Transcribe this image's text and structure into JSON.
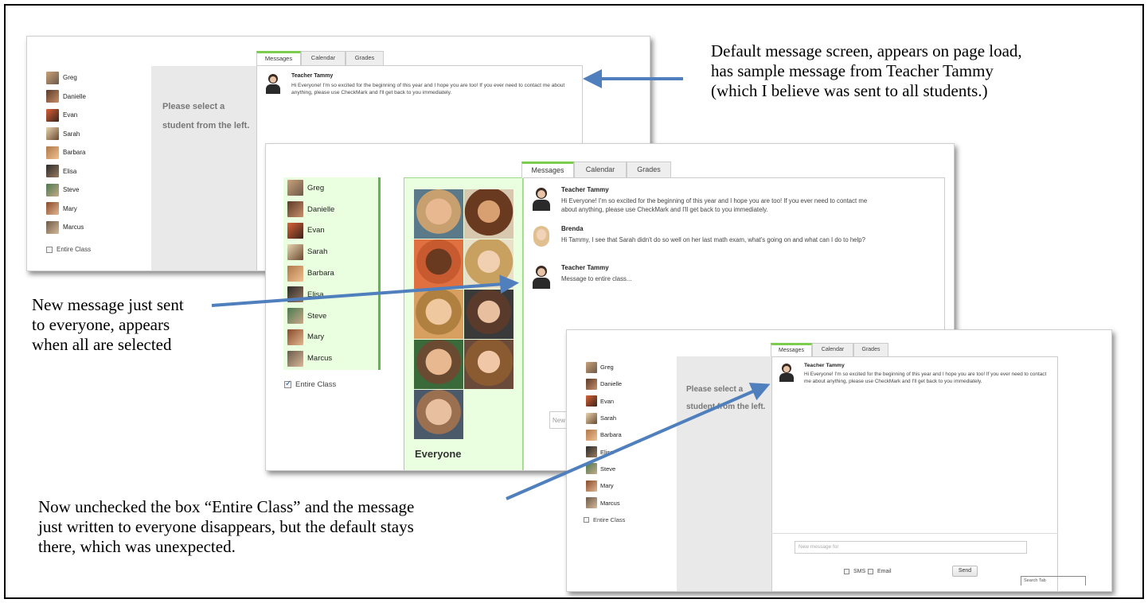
{
  "students": [
    "Greg",
    "Danielle",
    "Evan",
    "Sarah",
    "Barbara",
    "Elisa",
    "Steve",
    "Mary",
    "Marcus"
  ],
  "tabs": [
    "Messages",
    "Calendar",
    "Grades"
  ],
  "placeholder": [
    "Please select a",
    "student from the left."
  ],
  "entire_class": "Entire Class",
  "messages": [
    {
      "author": "Teacher Tammy",
      "text": "Hi Everyone! I'm so excited for the beginning of this year and I hope you are too! If you ever need to contact me about anything, please use CheckMark and I'll get back to you immediately."
    },
    {
      "author": "Brenda",
      "text": "Hi Tammy, I see that Sarah didn't do so well on her last math exam, what's going on and what can I do to help?"
    },
    {
      "author": "Teacher Tammy",
      "text": "Message to entire class..."
    }
  ],
  "group_label": "Everyone",
  "input_placeholder": "New message for",
  "input_cut": "New",
  "sms_label": "SMS",
  "email_label": "Email",
  "send_label": "Send",
  "search_stub": "Search Tab",
  "notes": {
    "top": [
      "Default message screen, appears on page load,",
      "has sample message from Teacher Tammy",
      "(which I believe was sent to all students.)"
    ],
    "middle": [
      "New message just sent",
      "to everyone, appears",
      "when all are selected"
    ],
    "bottom": [
      "Now unchecked the box “Entire Class” and the message",
      "just written to everyone disappears, but the default stays",
      "there, which was unexpected."
    ]
  },
  "colors": {
    "tab_accent": "#7ccc4e",
    "selected_bg": "#eaffdf",
    "selected_border": "#5db84a",
    "arrow": "#4f7fbc",
    "placeholder_bg": "#e9e9e9"
  }
}
